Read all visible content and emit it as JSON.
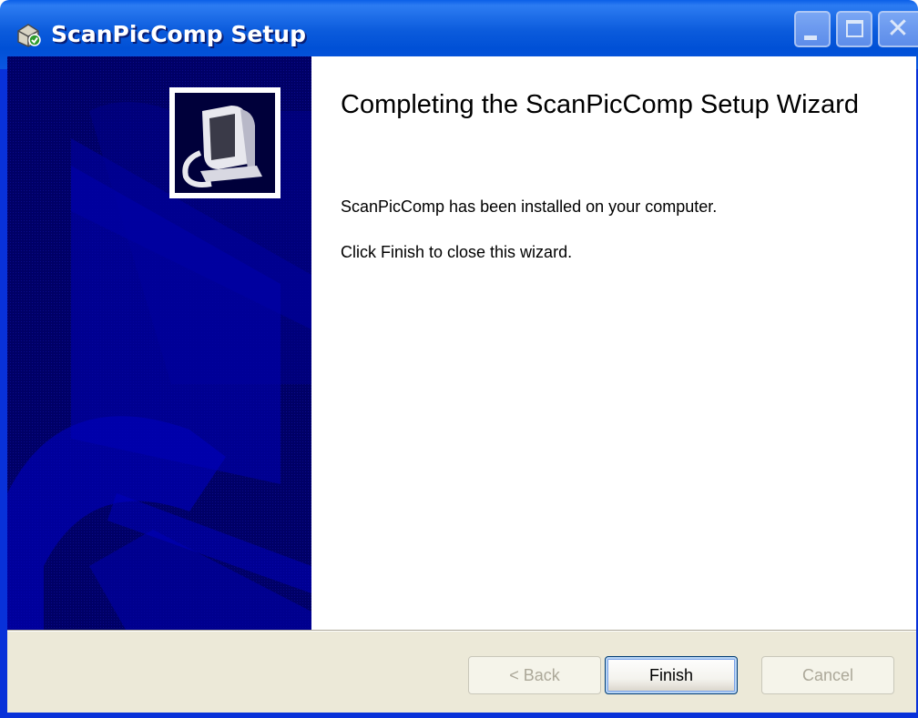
{
  "window": {
    "title": "ScanPicComp Setup",
    "title_icon": "installer-icon",
    "controls": [
      "minimize-icon",
      "maximize-icon",
      "close-icon"
    ],
    "close_glyph": "✕"
  },
  "banner": {
    "logo_icon": "computer-setup-icon"
  },
  "content": {
    "heading": "Completing the ScanPicComp Setup Wizard",
    "line1": "ScanPicComp has been installed on your computer.",
    "line2": "Click Finish to close this wizard."
  },
  "buttons": {
    "back": "< Back",
    "finish": "Finish",
    "cancel": "Cancel"
  },
  "colors": {
    "titlebar": "#0055e5",
    "banner": "#000066",
    "footer": "#ece9d8"
  }
}
